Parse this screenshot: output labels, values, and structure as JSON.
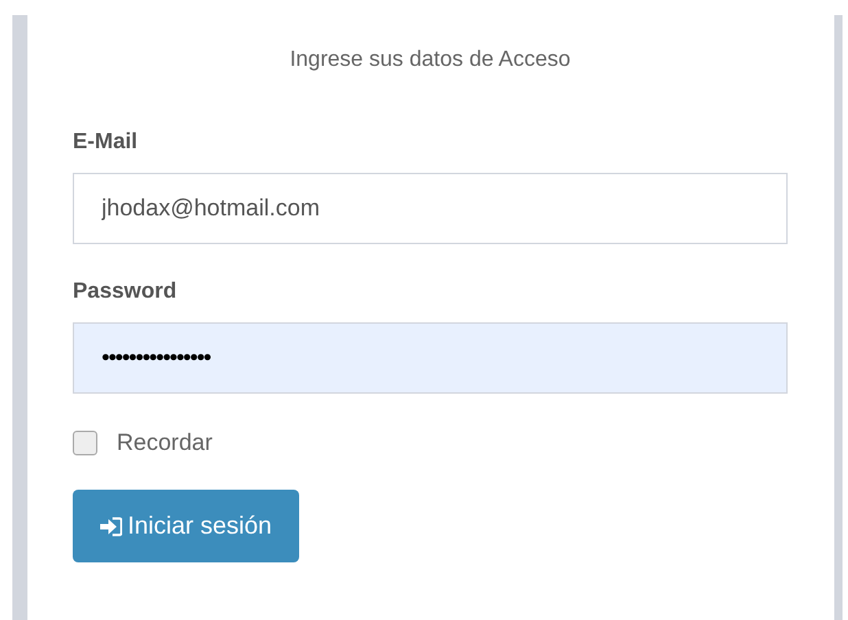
{
  "heading": "Ingrese sus datos de Acceso",
  "fields": [
    {
      "label": "E-Mail",
      "value": "jhodax@hotmail.com",
      "autofilled": false
    },
    {
      "label": "Password",
      "value": "••••••••••••••••",
      "autofilled": true
    }
  ],
  "remember": {
    "label": "Recordar",
    "checked": false
  },
  "submit": {
    "label": "Iniciar sesión"
  }
}
